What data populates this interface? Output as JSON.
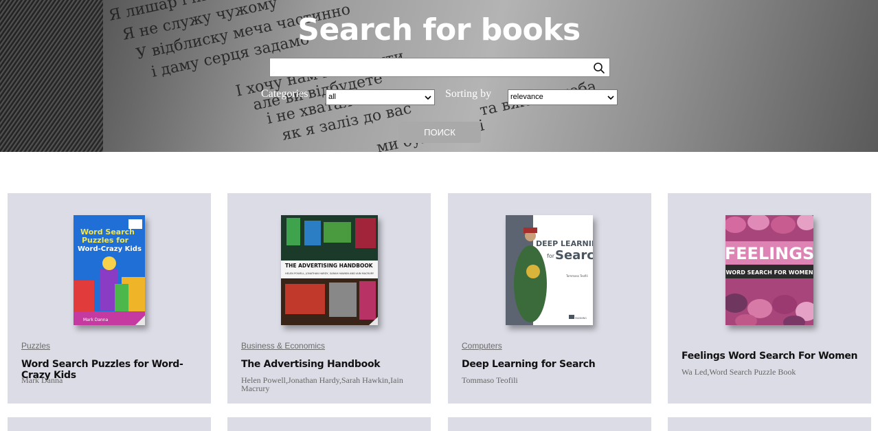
{
  "hero": {
    "title": "Search for books",
    "search": {
      "value": "",
      "placeholder": ""
    },
    "categories_label": "Categories",
    "categories_selected": "all",
    "sorting_label": "Sorting by",
    "sorting_selected": "relevance",
    "search_button": "поиск",
    "background_lines": [
      "Я лишар і пішов",
      "Я не служу чужому",
      "У відблиску меча частинно",
      "і даму серця задамо",
      "І хочу нам повернути",
      "але ви відбудете",
      "і не хватало",
      "та вже до неба",
      "як я заліз до вас",
      "ми були варті"
    ]
  },
  "books": [
    {
      "category": "Puzzles",
      "title": "Word Search Puzzles for Word-Crazy Kids",
      "authors": "Mark Danna",
      "cover_lines": [
        "Word Search",
        "Puzzles for",
        "Word-Crazy Kids"
      ],
      "cover_footer": "Mark Danna",
      "cover_badge": "Brain Games for Kids"
    },
    {
      "category": "Business & Economics",
      "title": "The Advertising Handbook",
      "authors": "Helen Powell,Jonathan Hardy,Sarah Hawkin,Iain Macrury",
      "cover_lines": [
        "THE ADVERTISING HANDBOOK"
      ],
      "cover_sub": "HELEN POWELL, JONATHAN HARDY, SARAH HAWKIN AND IAIN MACRURY"
    },
    {
      "category": "Computers",
      "title": "Deep Learning for Search",
      "authors": "Tommaso Teofili",
      "cover_lines": [
        "DEEP LEARNING",
        "for",
        "Search"
      ],
      "cover_author": "Tommaso Teofili",
      "cover_publisher": "MANNING"
    },
    {
      "category": "",
      "title": "Feelings Word Search For Women",
      "authors": "Wa Led,Word Search Puzzle Book",
      "cover_lines": [
        "FEELINGS"
      ],
      "cover_sub": "WORD SEARCH FOR WOMEN"
    }
  ]
}
